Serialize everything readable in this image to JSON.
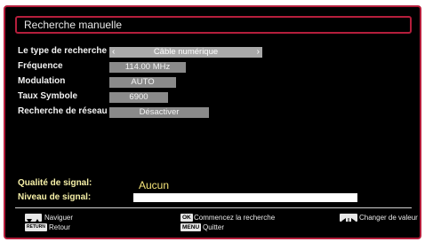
{
  "title": "Recherche manuelle",
  "rows": [
    {
      "label": "Le type de recherche",
      "value": "Câble numérique",
      "selected": true
    },
    {
      "label": "Fréquence",
      "value": "114.00 MHz",
      "selected": false
    },
    {
      "label": "Modulation",
      "value": "AUTO",
      "selected": false
    },
    {
      "label": "Taux Symbole",
      "value": "6900",
      "selected": false
    },
    {
      "label": "Recherche de réseau",
      "value": "Désactiver",
      "selected": false
    }
  ],
  "signal": {
    "quality_label": "Qualité de signal:",
    "quality_value": "Aucun",
    "level_label": "Niveau de signal:"
  },
  "help": {
    "navigate": "Naviguer",
    "back_key": "RETURN",
    "back": "Retour",
    "ok_key": "OK",
    "start": "Commencez la recherche",
    "menu_key": "MENU",
    "quit": "Quitter",
    "change": "Changer de valeur"
  },
  "colors": {
    "accent": "#b51e3c",
    "field": "#8a8a8a",
    "selected_field": "#a9a9a9",
    "signal_label": "#f7f1a8"
  }
}
